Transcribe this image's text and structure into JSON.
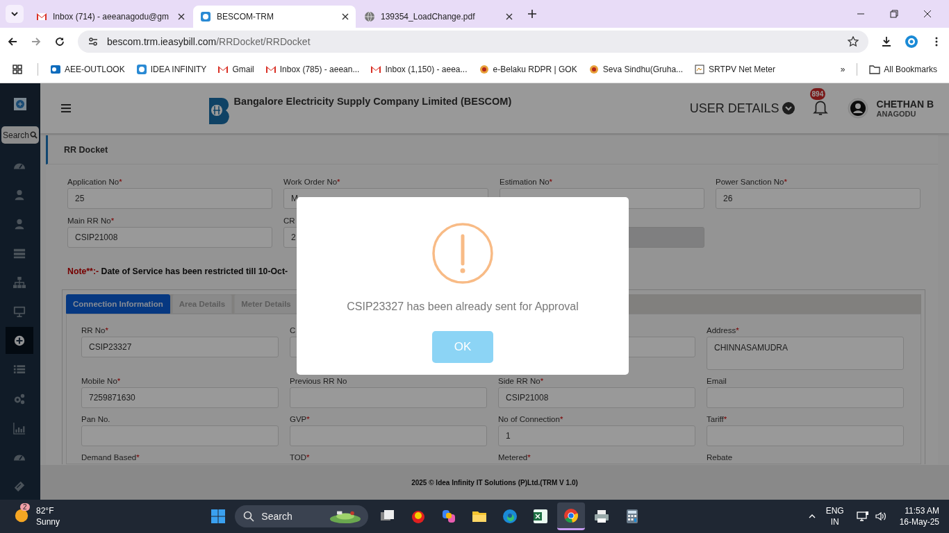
{
  "browser": {
    "tabs": [
      {
        "title": "Inbox (714) - aeeanagodu@gm",
        "kind": "mail",
        "selected": false
      },
      {
        "title": "BESCOM-TRM",
        "kind": "app",
        "selected": true
      },
      {
        "title": "139354_LoadChange.pdf",
        "kind": "globe",
        "selected": false
      }
    ],
    "address": {
      "host": "bescom.trm.ieasybill.com",
      "path": "/RRDocket/RRDocket"
    },
    "bookmarks": [
      {
        "label": "AEE-OUTLOOK",
        "kind": "outlook"
      },
      {
        "label": "IDEA INFINITY",
        "kind": "app"
      },
      {
        "label": "Gmail",
        "kind": "mail"
      },
      {
        "label": "Inbox (785) - aeean...",
        "kind": "mail"
      },
      {
        "label": "Inbox (1,150) - aeea...",
        "kind": "mail"
      },
      {
        "label": "e-Belaku RDPR | GOK",
        "kind": "emblem"
      },
      {
        "label": "Seva Sindhu(Gruha...",
        "kind": "emblem"
      },
      {
        "label": "SRTPV Net Meter",
        "kind": "doc"
      }
    ],
    "overflow": "»",
    "all_bookmarks": "All Bookmarks"
  },
  "app": {
    "sidebar": {
      "search": "Search",
      "items": [
        {
          "kind": "gauge",
          "selected": false
        },
        {
          "kind": "user",
          "selected": false
        },
        {
          "kind": "user",
          "selected": false
        },
        {
          "kind": "server",
          "selected": false
        },
        {
          "kind": "sitemap",
          "selected": false
        },
        {
          "kind": "monitor",
          "selected": false
        },
        {
          "kind": "plus",
          "selected": true
        },
        {
          "kind": "list",
          "selected": false
        },
        {
          "kind": "cogs",
          "selected": false
        },
        {
          "kind": "chart",
          "selected": false
        },
        {
          "kind": "gauge",
          "selected": false
        },
        {
          "kind": "ticket",
          "selected": false
        }
      ]
    },
    "header": {
      "title": "Bangalore Electricity Supply Company Limited (BESCOM)",
      "user_details": "USER DETAILS",
      "notifications": "894",
      "user_name": "CHETHAN B",
      "user_place": "ANAGODU"
    },
    "page_title": "RR Docket",
    "top_fields": [
      {
        "kind": "text",
        "label": "Application No",
        "mark": "*",
        "value": "25"
      },
      {
        "kind": "text",
        "label": "Work Order No",
        "mark": "*",
        "value": "M"
      },
      {
        "kind": "text",
        "label": "Estimation No",
        "mark": "*"
      },
      {
        "kind": "text",
        "label": "Power Sanction No",
        "mark": "*",
        "value": "26"
      },
      {
        "kind": "text",
        "label": "Main RR No",
        "mark": "*",
        "value": "CSIP21008"
      },
      {
        "kind": "text",
        "label": "CR",
        "value": "2"
      },
      {
        "kind": "disabled"
      }
    ],
    "note": {
      "prefix": "Note**:-",
      "text": "Date of Service has been restricted till 10-Oct-"
    },
    "tabs": [
      {
        "label": "Connection Information",
        "selected": true
      },
      {
        "label": "Area Details",
        "selected": false
      },
      {
        "label": "Meter Details",
        "selected": false
      }
    ],
    "fields": [
      {
        "kind": "text",
        "label": "RR No",
        "mark": "*",
        "value": "CSIP23327"
      },
      {
        "kind": "text",
        "label": "C"
      },
      {
        "kind": "text"
      },
      {
        "kind": "textarea",
        "label": "Address",
        "mark": "*",
        "value": "CHINNASAMUDRA"
      },
      {
        "kind": "text",
        "label": "Mobile No",
        "mark": "*",
        "value": "7259871630"
      },
      {
        "kind": "text",
        "label": "Previous RR No"
      },
      {
        "kind": "text",
        "label": "Side RR No",
        "mark": "*",
        "value": "CSIP21008"
      },
      {
        "kind": "text",
        "label": "Email"
      },
      {
        "kind": "text",
        "label": "Pan No."
      },
      {
        "kind": "text",
        "label": "GVP",
        "mark": "*"
      },
      {
        "kind": "text",
        "label": "No of Connection",
        "mark": "*",
        "value": "1"
      },
      {
        "kind": "text",
        "label": "Tariff",
        "mark": "*"
      },
      {
        "kind": "label",
        "label": "Demand Based",
        "mark": "*"
      },
      {
        "kind": "label",
        "label": "TOD",
        "mark": "*"
      },
      {
        "kind": "label",
        "label": "Metered",
        "mark": "*"
      },
      {
        "kind": "label",
        "label": "Rebate"
      }
    ],
    "footer": "2025 © Idea Infinity IT Solutions (P)Ltd.(TRM V 1.0)"
  },
  "dialog": {
    "message": "CSIP23327 has been already sent for Approval",
    "button": "OK"
  },
  "taskbar": {
    "weather": {
      "badge": "2",
      "temperature": "82°F",
      "condition": "Sunny"
    },
    "search": "Search",
    "apps": [
      {
        "kind": "taskview",
        "selected": false
      },
      {
        "kind": "game",
        "selected": false
      },
      {
        "kind": "copilot",
        "selected": false
      },
      {
        "kind": "folder",
        "selected": false
      },
      {
        "kind": "edge",
        "selected": false
      },
      {
        "kind": "excel",
        "selected": false
      },
      {
        "kind": "chrome",
        "selected": true
      },
      {
        "kind": "printer",
        "selected": false
      },
      {
        "kind": "calculator",
        "selected": false
      }
    ],
    "language": "ENG",
    "region": "IN",
    "time": "11:53 AM",
    "date": "16-May-25"
  }
}
